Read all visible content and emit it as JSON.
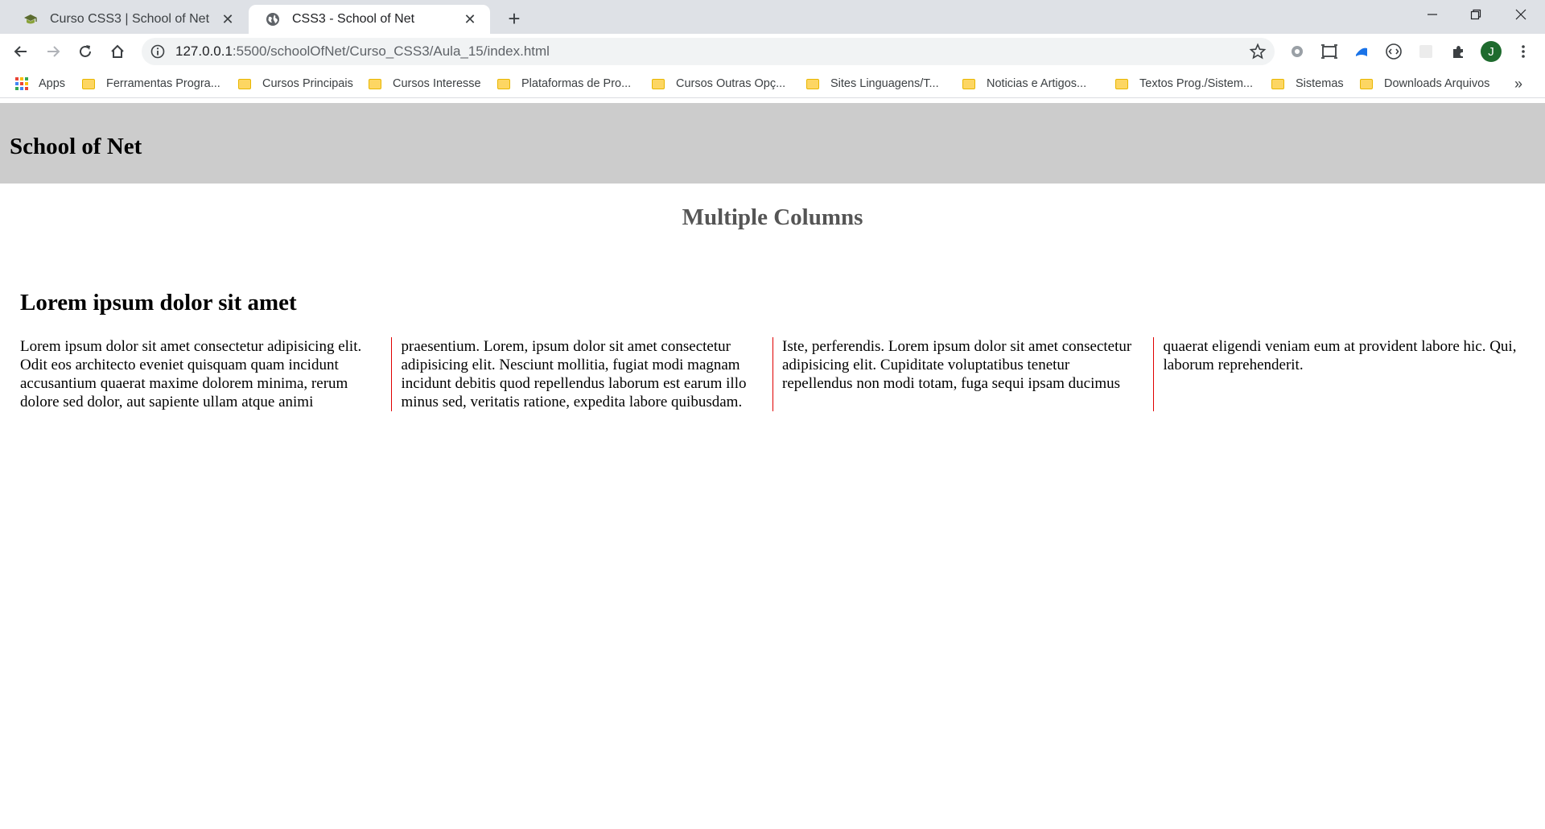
{
  "browser": {
    "tabs": [
      {
        "title": "Curso CSS3 | School of Net",
        "favicon": "graduation-cap-icon",
        "active": false
      },
      {
        "title": "CSS3 - School of Net",
        "favicon": "globe-icon",
        "active": true
      }
    ],
    "new_tab_label": "+",
    "url": {
      "host": "127.0.0.1",
      "path": ":5500/schoolOfNet/Curso_CSS3/Aula_15/index.html"
    },
    "profile_initial": "J",
    "bookmarks": [
      {
        "label": "Apps",
        "kind": "apps"
      },
      {
        "label": "Ferramentas Progra...",
        "kind": "folder"
      },
      {
        "label": "Cursos Principais",
        "kind": "folder"
      },
      {
        "label": "Cursos Interesse",
        "kind": "folder"
      },
      {
        "label": "Plataformas de Pro...",
        "kind": "folder"
      },
      {
        "label": "Cursos Outras Opç...",
        "kind": "folder"
      },
      {
        "label": "Sites Linguagens/T...",
        "kind": "folder"
      },
      {
        "label": "Noticias e Artigos...",
        "kind": "folder"
      },
      {
        "label": "Textos Prog./Sistem...",
        "kind": "folder"
      },
      {
        "label": "Sistemas",
        "kind": "folder"
      },
      {
        "label": "Downloads Arquivos",
        "kind": "folder"
      }
    ],
    "bookmarks_overflow": "»"
  },
  "page": {
    "site_title": "School of Net",
    "section_title": "Multiple Columns",
    "article_title": "Lorem ipsum dolor sit amet",
    "article_body": "Lorem ipsum dolor sit amet consectetur adipisicing elit. Odit eos architecto eveniet quisquam quam incidunt accusantium quaerat maxime dolorem minima, rerum dolore sed dolor, aut sapiente ullam atque animi praesentium. Lorem, ipsum dolor sit amet consectetur adipisicing elit. Nesciunt mollitia, fugiat modi magnam incidunt debitis quod repellendus laborum est earum illo minus sed, veritatis ratione, expedita labore quibusdam. Iste, perferendis. Lorem ipsum dolor sit amet consectetur adipisicing elit. Cupiditate voluptatibus tenetur repellendus non modi totam, fuga sequi ipsam ducimus quaerat eligendi veniam eum at provident labore hic. Qui, laborum reprehenderit."
  },
  "colors": {
    "header_bg": "#cccccc",
    "section_title": "#555555",
    "column_rule": "#e00000"
  }
}
